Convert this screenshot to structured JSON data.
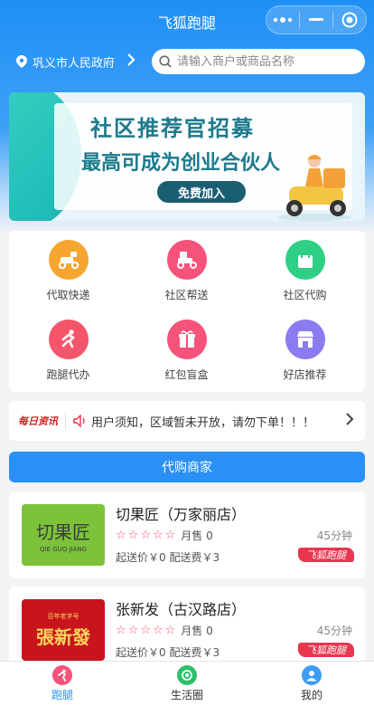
{
  "app": {
    "title": "飞狐跑腿"
  },
  "location": {
    "name": "巩义市人民政府"
  },
  "search": {
    "placeholder": "请输入商户或商品名称"
  },
  "banner": {
    "title": "社区推荐官招募",
    "subtitle": "最高可成为创业合伙人",
    "button": "免费加入"
  },
  "services": [
    {
      "label": "代取快递",
      "icon": "scooter-icon",
      "color": "#f7a531"
    },
    {
      "label": "社区帮送",
      "icon": "delivery-icon",
      "color": "#f5537a"
    },
    {
      "label": "社区代购",
      "icon": "shopping-bag-icon",
      "color": "#2fcf86"
    },
    {
      "label": "跑腿代办",
      "icon": "runner-icon",
      "color": "#f5556a"
    },
    {
      "label": "红包盲盒",
      "icon": "gift-box-icon",
      "color": "#f5537a"
    },
    {
      "label": "好店推荐",
      "icon": "storefront-icon",
      "color": "#8a7cf0"
    }
  ],
  "notice": {
    "tag": "每日资讯",
    "text": "用户须知，区域暂未开放，请勿下单！！！"
  },
  "section": {
    "title": "代购商家"
  },
  "shops": [
    {
      "name": "切果匠（万家丽店）",
      "sold": "月售 0",
      "fees": "起送价￥0  配送费￥3",
      "eta": "45分钟",
      "tag": "飞狐跑腿",
      "logo_text": "切果匠",
      "logo_sub": "QIE GUO JIANG",
      "logo_color": "#7cc23b"
    },
    {
      "name": "张新发（古汉路店）",
      "sold": "月售 0",
      "fees": "起送价￥0  配送费￥3",
      "eta": "45分钟",
      "tag": "飞狐跑腿",
      "logo_text": "張新發",
      "logo_sub": "百年老字号",
      "logo_color": "#c8141d"
    }
  ],
  "tabs": [
    {
      "label": "跑腿",
      "icon": "run-icon",
      "color": "#f5537a"
    },
    {
      "label": "生活圈",
      "icon": "life-circle-icon",
      "color": "#2fbf6a"
    },
    {
      "label": "我的",
      "icon": "user-icon",
      "color": "#3c9df5"
    }
  ]
}
